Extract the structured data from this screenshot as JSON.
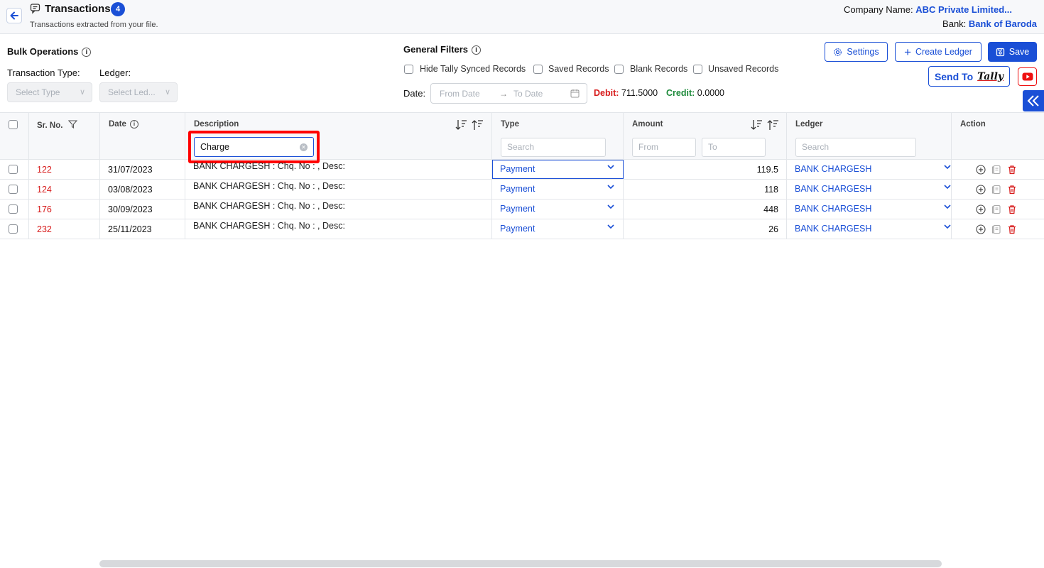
{
  "header": {
    "title": "Transactions",
    "count_badge": "4",
    "subtitle": "Transactions extracted from your file.",
    "company_label": "Company Name:",
    "company_value": "ABC Private Limited...",
    "bank_label": "Bank:",
    "bank_value": "Bank of Baroda"
  },
  "bulk": {
    "title": "Bulk Operations",
    "type_label": "Transaction Type:",
    "ledger_label": "Ledger:",
    "type_placeholder": "Select Type",
    "ledger_placeholder": "Select Led..."
  },
  "filters": {
    "title": "General Filters",
    "checkboxes": [
      "Hide Tally Synced Records",
      "Saved Records",
      "Blank Records",
      "Unsaved Records"
    ],
    "date_label": "Date:",
    "from_placeholder": "From Date",
    "to_placeholder": "To Date",
    "debit_label": "Debit:",
    "debit_value": "711.5000",
    "credit_label": "Credit:",
    "credit_value": "0.0000"
  },
  "buttons": {
    "settings": "Settings",
    "create_ledger": "Create Ledger",
    "save": "Save",
    "send_to": "Send To",
    "tally_logo": "Tally"
  },
  "table": {
    "headers": {
      "sr": "Sr. No.",
      "date": "Date",
      "description": "Description",
      "type": "Type",
      "amount": "Amount",
      "ledger": "Ledger",
      "action": "Action"
    },
    "filters": {
      "description_value": "Charge",
      "type_placeholder": "Search",
      "amount_from": "From",
      "amount_to": "To",
      "ledger_placeholder": "Search"
    },
    "rows": [
      {
        "sr": "122",
        "date": "31/07/2023",
        "description": "BANK CHARGESH : Chq. No : , Desc:",
        "type": "Payment",
        "amount": "119.5",
        "ledger": "BANK CHARGESH"
      },
      {
        "sr": "124",
        "date": "03/08/2023",
        "description": "BANK CHARGESH : Chq. No : , Desc:",
        "type": "Payment",
        "amount": "118",
        "ledger": "BANK CHARGESH"
      },
      {
        "sr": "176",
        "date": "30/09/2023",
        "description": "BANK CHARGESH : Chq. No : , Desc:",
        "type": "Payment",
        "amount": "448",
        "ledger": "BANK CHARGESH"
      },
      {
        "sr": "232",
        "date": "25/11/2023",
        "description": "BANK CHARGESH : Chq. No : , Desc:",
        "type": "Payment",
        "amount": "26",
        "ledger": "BANK CHARGESH"
      }
    ]
  },
  "colors": {
    "accent": "#1a4fd6",
    "debit": "#d71a1a",
    "credit": "#1d8a3a",
    "highlight": "#ff0000"
  }
}
